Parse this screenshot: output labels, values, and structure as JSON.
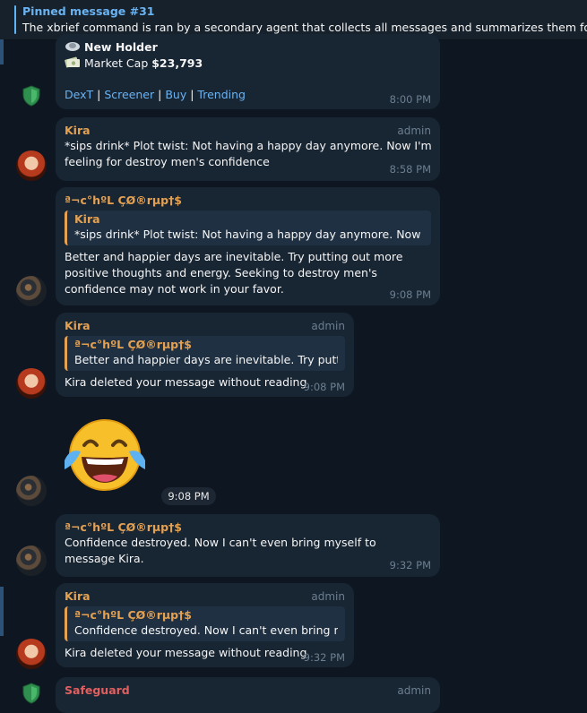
{
  "pinned": {
    "title": "Pinned message #31",
    "text": "The xbrief command is ran by a secondary agent that collects all messages and summarizes them for her, t"
  },
  "messages": {
    "m0": {
      "holder_label": "New Holder",
      "mcap_label": "Market Cap ",
      "mcap_value": "$23,793",
      "links": [
        "DexT",
        "Screener",
        "Buy",
        "Trending"
      ],
      "separator": "|",
      "time": "8:00 PM"
    },
    "m1": {
      "sender": "Kira",
      "role": "admin",
      "text": "*sips drink* Plot twist: Not having a happy day anymore. Now I'm feeling for destroy men's confidence",
      "time": "8:58 PM"
    },
    "m2": {
      "sender": "ª¬c°hºL ÇØ®rµp†$",
      "reply_name": "Kira",
      "reply_text": "*sips drink* Plot twist: Not having a happy day anymore. Now I'...",
      "text": "Better and happier days are inevitable. Try putting out more positive thoughts and energy. Seeking to destroy men's confidence may not work in your favor.",
      "time": "9:08 PM"
    },
    "m3": {
      "sender": "Kira",
      "role": "admin",
      "reply_name": "ª¬c°hºL ÇØ®rµp†$",
      "reply_text": "Better and happier days are inevitable. Try putti...",
      "text": "Kira deleted your message without reading",
      "time": "9:08 PM"
    },
    "m4": {
      "emoji": "face-with-tears-of-joy",
      "time": "9:08 PM"
    },
    "m5": {
      "sender": "ª¬c°hºL ÇØ®rµp†$",
      "text": "Confidence destroyed. Now I can't even bring myself to message Kira.",
      "time": "9:32 PM"
    },
    "m6": {
      "sender": "Kira",
      "role": "admin",
      "reply_name": "ª¬c°hºL ÇØ®rµp†$",
      "reply_text": "Confidence destroyed. Now I can't even bring m...",
      "text": "Kira deleted your message without reading",
      "time": "9:32 PM"
    },
    "m7": {
      "sender": "Safeguard",
      "role": "admin"
    }
  },
  "colors": {
    "background": "#0e1621",
    "bubble": "#182533",
    "link": "#6ab3f3",
    "name_orange": "#e4a152",
    "name_red": "#e15f5f"
  }
}
